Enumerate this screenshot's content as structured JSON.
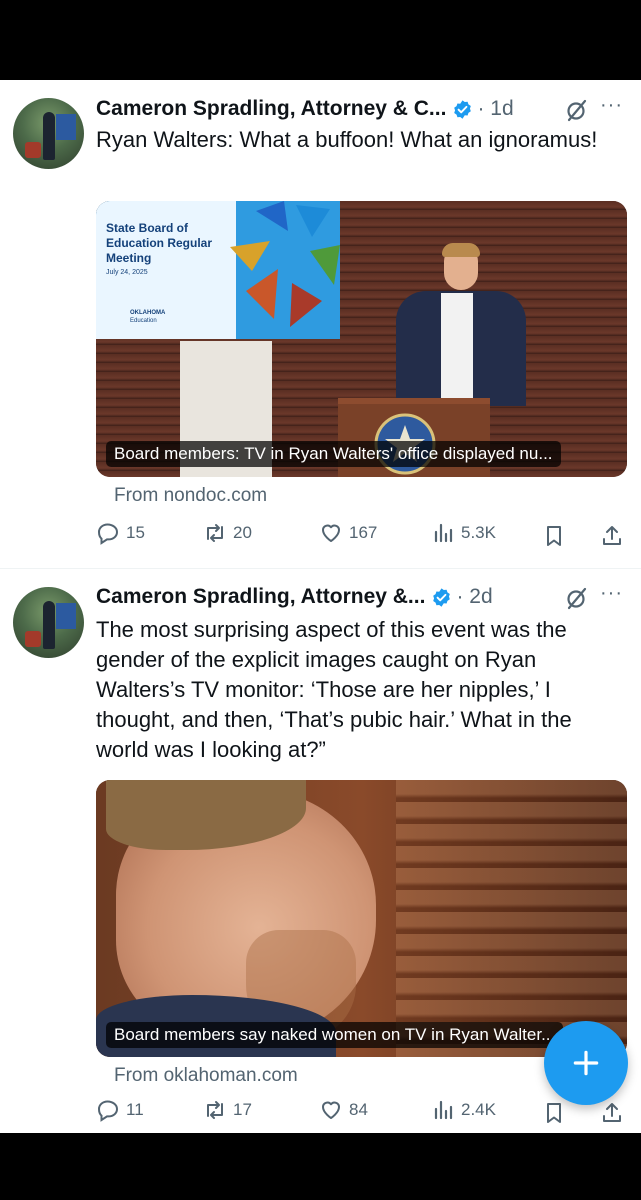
{
  "colors": {
    "accent": "#1d9bf0",
    "secondary_text": "#536471",
    "text": "#0f1419"
  },
  "posts": [
    {
      "author": "Cameron Spradling, Attorney & C...",
      "time": "· 1d",
      "more": "···",
      "text": "Ryan Walters: What a buffoon! What an ignoramus!",
      "card": {
        "screen_title": "State Board of Education Regular Meeting",
        "screen_date": "July 24, 2025",
        "screen_logo_top": "OKLAHOMA",
        "screen_logo_bottom": "Education",
        "caption": "Board members: TV in Ryan Walters' office displayed nu...",
        "source": "From nondoc.com"
      },
      "stats": {
        "replies": "15",
        "reposts": "20",
        "likes": "167",
        "views": "5.3K"
      }
    },
    {
      "author": "Cameron Spradling, Attorney &...",
      "time": "· 2d",
      "more": "···",
      "text": "The most surprising aspect of this event was the gender of the explicit images caught on Ryan Walters’s TV monitor: ‘Those are her nipples,’ I thought, and then, ‘That’s pubic hair.’ What in the world was I looking at?”",
      "card": {
        "caption": "Board members say naked women on TV in Ryan Walter...",
        "source": "From oklahoman.com"
      },
      "stats": {
        "replies": "11",
        "reposts": "17",
        "likes": "84",
        "views": "2.4K"
      }
    }
  ],
  "icons": {
    "verified": "verified-badge-icon",
    "grok": "grok-icon",
    "reply": "reply-icon",
    "repost": "repost-icon",
    "like": "heart-icon",
    "views": "views-icon",
    "bookmark": "bookmark-icon",
    "share": "share-icon",
    "compose": "plus-icon"
  }
}
